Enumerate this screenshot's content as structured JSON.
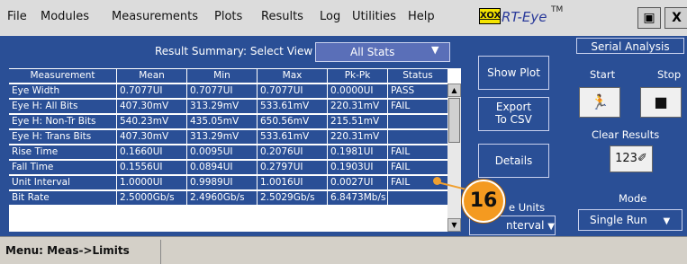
{
  "menu": [
    "File",
    "Modules",
    "Measurements",
    "Plots",
    "Results",
    "Log",
    "Utilities",
    "Help"
  ],
  "logo": {
    "badge": "XOX",
    "name": "RT-Eye",
    "tm": "TM"
  },
  "window_buttons": {
    "restore": "▣",
    "close": "X"
  },
  "result_summary": {
    "label": "Result Summary: Select View",
    "value": "All Stats"
  },
  "table": {
    "headers": [
      "Measurement",
      "Mean",
      "Min",
      "Max",
      "Pk-Pk",
      "Status"
    ],
    "rows": [
      [
        "Eye Width",
        "0.7077UI",
        "0.7077UI",
        "0.7077UI",
        "0.0000UI",
        "PASS"
      ],
      [
        "Eye H: All Bits",
        "407.30mV",
        "313.29mV",
        "533.61mV",
        "220.31mV",
        "FAIL"
      ],
      [
        "Eye H: Non-Tr Bits",
        "540.23mV",
        "435.05mV",
        "650.56mV",
        "215.51mV",
        ""
      ],
      [
        "Eye H: Trans Bits",
        "407.30mV",
        "313.29mV",
        "533.61mV",
        "220.31mV",
        ""
      ],
      [
        "Rise Time",
        "0.1660UI",
        "0.0095UI",
        "0.2076UI",
        "0.1981UI",
        "FAIL"
      ],
      [
        "Fall Time",
        "0.1556UI",
        "0.0894UI",
        "0.2797UI",
        "0.1903UI",
        "FAIL"
      ],
      [
        "Unit Interval",
        "1.0000UI",
        "0.9989UI",
        "1.0016UI",
        "0.0027UI",
        "FAIL"
      ],
      [
        "Bit Rate",
        "2.5000Gb/s",
        "2.4960Gb/s",
        "2.5029Gb/s",
        "6.8473Mb/s",
        ""
      ]
    ]
  },
  "buttons": {
    "show_plot": "Show Plot",
    "export_line1": "Export",
    "export_line2": "To CSV",
    "details": "Details",
    "units_label": "e Units",
    "units_value": "nterval"
  },
  "callout": "16",
  "serial_analysis": {
    "title": "Serial Analysis",
    "start": "Start",
    "stop": "Stop",
    "clear_results": "Clear Results",
    "mode_label": "Mode",
    "mode_value": "Single Run"
  },
  "status_bar": "Menu: Meas->Limits",
  "colors": {
    "panel": "#2a4f96",
    "accent": "#f49a20"
  }
}
